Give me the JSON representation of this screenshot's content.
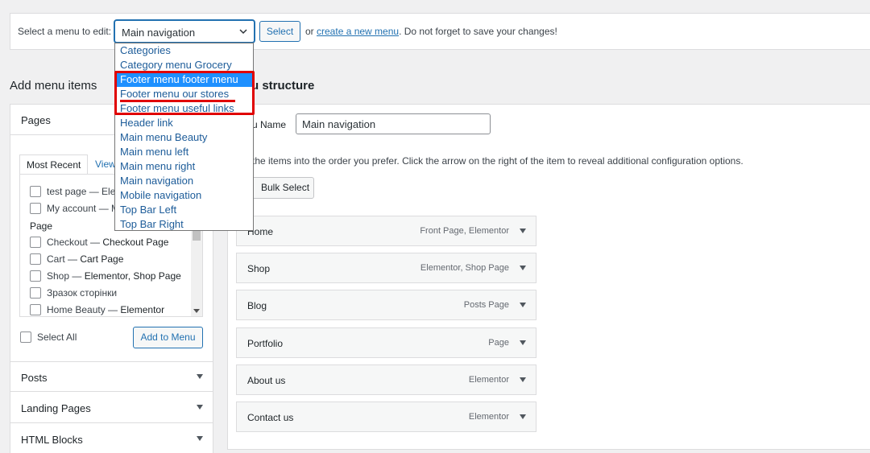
{
  "select_bar": {
    "label": "Select a menu to edit:",
    "selected_menu": "Main navigation",
    "select_button": "Select",
    "or_text": "or",
    "create_link": "create a new menu",
    "tail_text": ". Do not forget to save your changes!"
  },
  "dropdown": {
    "options": [
      "Categories",
      "Category menu Grocery",
      "Footer menu footer menu",
      "Footer menu our stores",
      "Footer menu useful links",
      "Header link",
      "Main menu Beauty",
      "Main menu left",
      "Main menu right",
      "Main navigation",
      "Mobile navigation",
      "Top Bar Left",
      "Top Bar Right"
    ],
    "highlighted_index": 2
  },
  "add_menu_items": {
    "heading": "Add menu items",
    "pages_title": "Pages",
    "tabs": [
      "Most Recent",
      "View"
    ],
    "recent_items": [
      "test page — Ele",
      "My account — M"
    ],
    "group_label": "Page",
    "page_items": [
      {
        "title": "Checkout — ",
        "bold": "Checkout Page"
      },
      {
        "title": "Cart — ",
        "bold": "Cart Page"
      },
      {
        "title": "Shop — ",
        "bold": "Elementor, Shop Page"
      },
      {
        "title": "Зразок сторінки",
        "bold": ""
      },
      {
        "title": "Home Beauty — ",
        "bold": "Elementor"
      }
    ],
    "select_all": "Select All",
    "add_button": "Add to Menu",
    "sections": [
      "Posts",
      "Landing Pages",
      "HTML Blocks"
    ]
  },
  "menu_structure": {
    "heading": "u structure",
    "name_label": "u Name",
    "name_value": "Main navigation",
    "instructions": "the items into the order you prefer. Click the arrow on the right of the item to reveal additional configuration options.",
    "bulk_select": "Bulk Select",
    "items": [
      {
        "title": "Home",
        "type": "Front Page, Elementor"
      },
      {
        "title": "Shop",
        "type": "Elementor, Shop Page"
      },
      {
        "title": "Blog",
        "type": "Posts Page"
      },
      {
        "title": "Portfolio",
        "type": "Page"
      },
      {
        "title": "About us",
        "type": "Elementor"
      },
      {
        "title": "Contact us",
        "type": "Elementor"
      }
    ]
  },
  "colors": {
    "accent": "#2271b1",
    "highlight": "#1e90ff",
    "annotation_red": "#e00000"
  }
}
